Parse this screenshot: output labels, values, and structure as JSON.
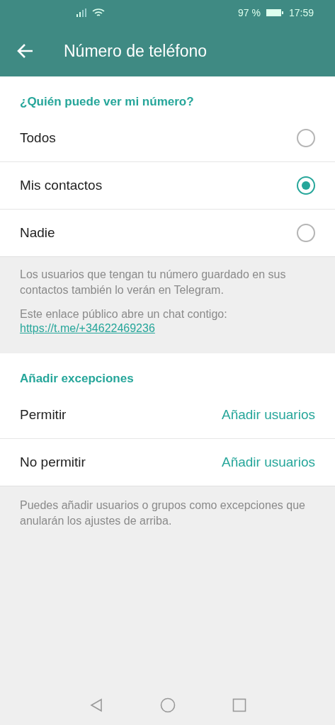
{
  "status_bar": {
    "battery": "97 %",
    "time": "17:59"
  },
  "app_bar": {
    "title": "Número de teléfono"
  },
  "visibility": {
    "header": "¿Quién puede ver mi número?",
    "options": [
      {
        "label": "Todos",
        "selected": false
      },
      {
        "label": "Mis contactos",
        "selected": true
      },
      {
        "label": "Nadie",
        "selected": false
      }
    ]
  },
  "info": {
    "note": "Los usuarios que tengan tu número guardado en sus contactos también lo verán en Telegram.",
    "link_intro": "Este enlace público abre un chat contigo:",
    "link": "https://t.me/+34622469236"
  },
  "exceptions": {
    "header": "Añadir excepciones",
    "rows": [
      {
        "label": "Permitir",
        "action": "Añadir usuarios"
      },
      {
        "label": "No permitir",
        "action": "Añadir usuarios"
      }
    ]
  },
  "footer_note": "Puedes añadir usuarios o grupos como excepciones que anularán los ajustes de arriba."
}
